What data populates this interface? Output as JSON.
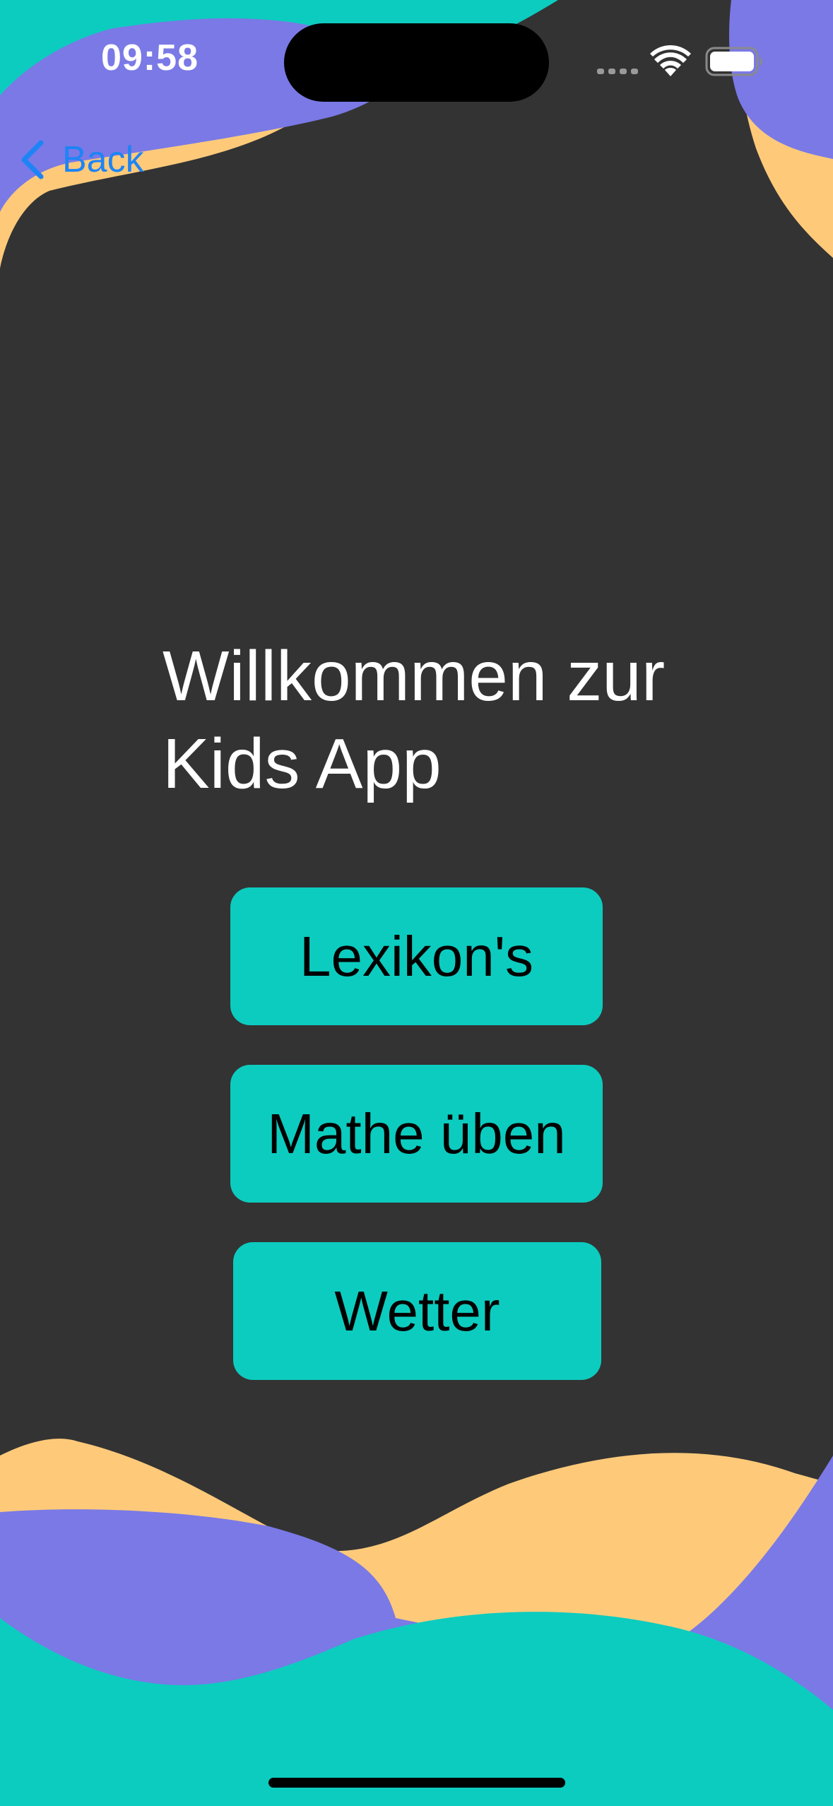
{
  "status_bar": {
    "time": "09:58"
  },
  "navigation": {
    "back_label": "Back",
    "back_icon": "chevron-left-icon"
  },
  "main": {
    "welcome_line1": "Willkommen zur",
    "welcome_line2": "Kids App",
    "buttons": [
      {
        "label": "Lexikon's"
      },
      {
        "label": "Mathe üben"
      },
      {
        "label": "Wetter"
      }
    ]
  },
  "colors": {
    "background": "#333333",
    "turquoise": "#0CCCBF",
    "purple": "#7A79E6",
    "peach": "#FECA7A",
    "link_blue": "#1E84F5"
  }
}
